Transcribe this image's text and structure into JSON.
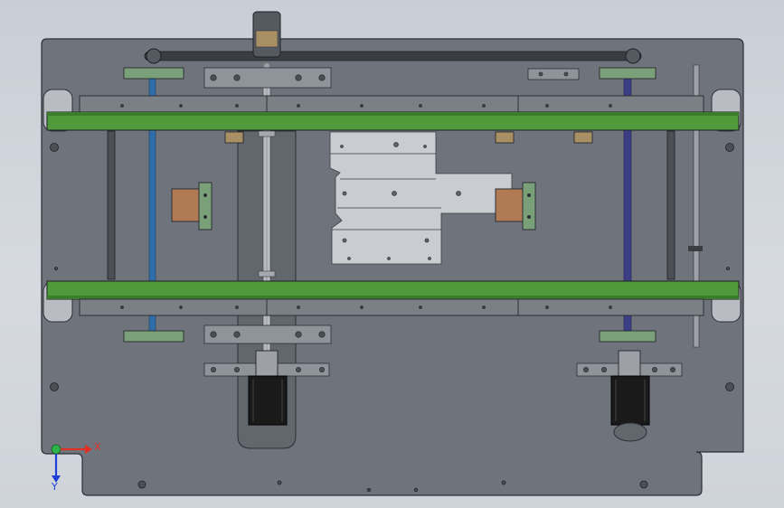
{
  "viewport": {
    "background_top": "#c9ced6",
    "background_bottom": "#d6dae0"
  },
  "model": {
    "plate_color": "#6f747c",
    "plate_edge": "#2c2f34",
    "belt_color": "#4f9a3a",
    "rail_color": "#7b7f86",
    "bracket_color": "#8f949b",
    "slot_color": "#62666d",
    "sheet_color": "#c9ccd0",
    "motor_body": "#1a1a1a",
    "blue_shaft": "#2f6ea8",
    "purple_shaft": "#3d3f86",
    "copper_block": "#b07a55"
  },
  "triad": {
    "x_label": "X",
    "y_label": "Y",
    "x_color": "#e03024",
    "y_color": "#1f3fd8",
    "origin_color": "#2fb24a"
  }
}
